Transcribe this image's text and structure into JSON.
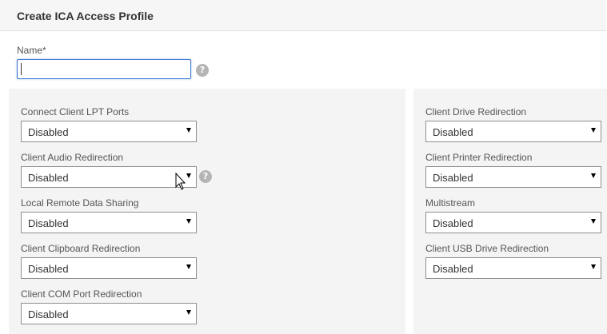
{
  "header": {
    "title": "Create ICA Access Profile"
  },
  "name_field": {
    "label": "Name*",
    "value": "",
    "help_icon": "question-circle-icon"
  },
  "left_column": [
    {
      "label": "Connect Client LPT Ports",
      "value": "Disabled"
    },
    {
      "label": "Client Audio Redirection",
      "value": "Disabled",
      "help_icon": "question-circle-icon"
    },
    {
      "label": "Local Remote Data Sharing",
      "value": "Disabled"
    },
    {
      "label": "Client Clipboard Redirection",
      "value": "Disabled"
    },
    {
      "label": "Client COM Port Redirection",
      "value": "Disabled"
    }
  ],
  "right_column": [
    {
      "label": "Client Drive Redirection",
      "value": "Disabled"
    },
    {
      "label": "Client Printer Redirection",
      "value": "Disabled"
    },
    {
      "label": "Multistream",
      "value": "Disabled"
    },
    {
      "label": "Client USB Drive Redirection",
      "value": "Disabled"
    }
  ],
  "colors": {
    "focus_border": "#3e7bd6",
    "panel_bg": "#f4f4f4",
    "header_bg": "#f6f6f6",
    "help_icon": "#b5b5b5"
  },
  "help_glyph": "?"
}
